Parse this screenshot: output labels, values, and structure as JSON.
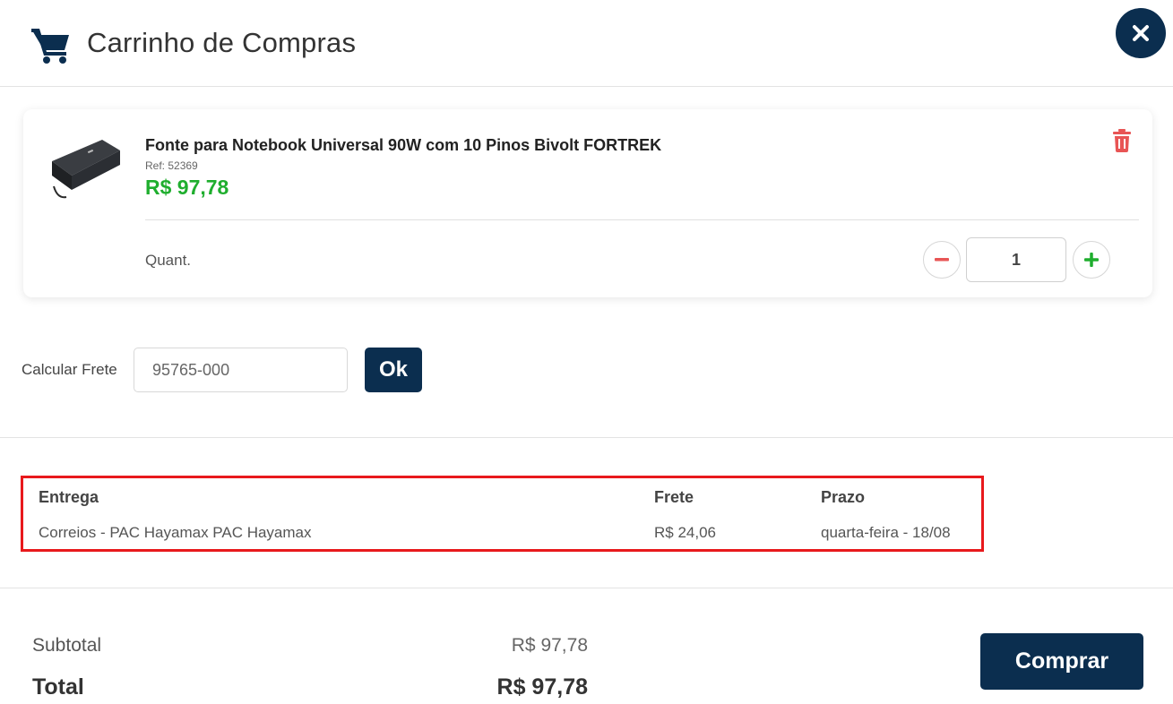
{
  "header": {
    "title": "Carrinho de Compras",
    "cart_icon": "shopping-cart-icon",
    "close_icon": "close-icon"
  },
  "product": {
    "name": "Fonte para Notebook Universal 90W com 10 Pinos Bivolt FORTREK",
    "ref": "Ref: 52369",
    "price": "R$ 97,78",
    "image_icon": "notebook-power-adapter-image",
    "remove_icon": "trash-icon",
    "quantity_label": "Quant.",
    "quantity": "1"
  },
  "shipping": {
    "label": "Calcular Frete",
    "cep_value": "95765-000",
    "ok_label": "Ok",
    "columns": [
      "Entrega",
      "Frete",
      "Prazo"
    ],
    "rows": [
      [
        "Correios - PAC Hayamax PAC Hayamax",
        "R$ 24,06",
        "quarta-feira - 18/08"
      ]
    ]
  },
  "summary": {
    "subtotal_label": "Subtotal",
    "subtotal_value": "R$ 97,78",
    "total_label": "Total",
    "total_value": "R$ 97,78",
    "buy_label": "Comprar"
  },
  "colors": {
    "primary": "#0b2e4f",
    "price_green": "#1fae2e",
    "danger_red": "#e8191c",
    "remove_red": "#e85555"
  }
}
